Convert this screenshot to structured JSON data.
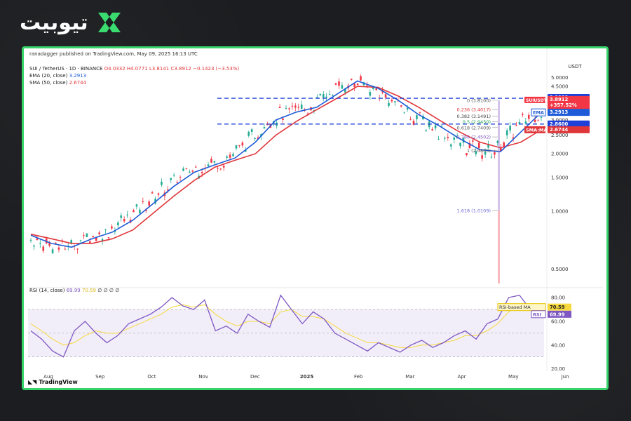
{
  "brand": {
    "name": "تیوبیت"
  },
  "published": "ranadagger published on TradingView.com, May 09, 2025 16:13 UTC",
  "symbol_line": {
    "name": "SUI / TetherUS · 1D · BINANCE",
    "ohlc": "O4.0332 H4.0771 L3.8141 C3.8912 −0.1423 (−3.53%)"
  },
  "ema_legend": {
    "label": "EMA (20, close)",
    "value": "3.2913"
  },
  "sma_legend": {
    "label": "SMA (50, close)",
    "value": "2.6744"
  },
  "rsi_legend": {
    "label": "RSI (14, close)",
    "v1": "69.99",
    "v2": "70.59",
    "rest": "∅ ∅ ∅ ∅"
  },
  "footer": {
    "tradingview": "TradingView"
  },
  "colors": {
    "green": "#22ab94",
    "red": "#f23645",
    "ema": "#1e5bd8",
    "sma": "#e0363a",
    "rsi": "#7e57c2",
    "rsi_ma": "#f7d83d",
    "accent": "#37d46a"
  },
  "chart_data": [
    {
      "type": "line",
      "title": "SUI / TetherUS · 1D · BINANCE",
      "currency": "USDT",
      "x_ticks": [
        "Aug",
        "Sep",
        "Oct",
        "Nov",
        "Dec",
        "2025",
        "Feb",
        "Mar",
        "Apr",
        "May",
        "Jun"
      ],
      "y_ticks": [
        "5.0000",
        "4.5000",
        "4.0000",
        "3.5000",
        "3.0000",
        "2.5000",
        "2.0000",
        "1.5000",
        "1.0000",
        "0.5000"
      ],
      "y_scale": "log",
      "ylim": [
        0.42,
        5.9
      ],
      "series": [
        {
          "name": "EMA",
          "values": [
            0.75,
            0.68,
            0.65,
            0.72,
            0.78,
            0.9,
            1.1,
            1.35,
            1.6,
            1.75,
            1.9,
            2.3,
            3.0,
            3.3,
            3.5,
            4.1,
            4.8,
            4.4,
            3.8,
            3.2,
            2.8,
            2.4,
            2.1,
            2.05,
            2.6,
            3.29
          ]
        },
        {
          "name": "SMA",
          "values": [
            0.76,
            0.72,
            0.68,
            0.68,
            0.72,
            0.8,
            0.98,
            1.2,
            1.45,
            1.7,
            1.85,
            2.0,
            2.5,
            2.95,
            3.4,
            3.9,
            4.5,
            4.45,
            4.0,
            3.5,
            3.0,
            2.6,
            2.3,
            2.15,
            2.3,
            2.67
          ]
        }
      ],
      "horizontal_levels": [
        {
          "label": "3.9000",
          "value": 3.9,
          "style": "dashed"
        },
        {
          "label": "2.8600",
          "value": 2.86,
          "style": "dashed"
        }
      ],
      "fib_levels": [
        {
          "label": "0 (3.8100)",
          "value": 3.81
        },
        {
          "label": "0.236 (3.4017)",
          "value": 3.4017
        },
        {
          "label": "0.382 (3.1491)",
          "value": 3.1491
        },
        {
          "label": "0.5 (2.9450)",
          "value": 2.945
        },
        {
          "label": "0.618 (2.7409)",
          "value": 2.7409
        },
        {
          "label": "0.786 (2.4502)",
          "value": 2.4502
        },
        {
          "label": "1 (2.0800)",
          "value": 2.08
        },
        {
          "label": "1.618 (1.0109)",
          "value": 1.0109
        }
      ],
      "price_tags": [
        {
          "text": "3.9000",
          "color": "#1e40d8"
        },
        {
          "text": "SUIUSDT",
          "value": "3.8912",
          "extra": "+357.52%",
          "timer": "07:46:16",
          "color": "#f23645"
        },
        {
          "text": "EMA",
          "value": "3.2913",
          "color": "#1e5bd8"
        },
        {
          "text": "2.8600",
          "color": "#1e40d8"
        },
        {
          "text": "SMA:MA",
          "value": "2.6744",
          "color": "#e0363a"
        }
      ]
    },
    {
      "type": "line",
      "title": "RSI (14, close)",
      "y_ticks": [
        "80.00",
        "60.00",
        "40.00",
        "20.00"
      ],
      "ylim": [
        18,
        86
      ],
      "band": [
        30,
        70
      ],
      "series": [
        {
          "name": "RSI",
          "values": [
            52,
            45,
            35,
            30,
            52,
            60,
            50,
            42,
            48,
            58,
            62,
            66,
            72,
            80,
            73,
            70,
            78,
            52,
            56,
            50,
            66,
            60,
            55,
            82,
            70,
            58,
            68,
            62,
            50,
            45,
            40,
            35,
            42,
            38,
            34,
            40,
            44,
            38,
            42,
            48,
            52,
            45,
            58,
            62,
            80,
            82,
            70,
            69.99
          ]
        },
        {
          "name": "RSI-based MA",
          "values": [
            58,
            52,
            45,
            40,
            42,
            48,
            52,
            50,
            50,
            54,
            58,
            62,
            66,
            72,
            74,
            72,
            74,
            66,
            60,
            56,
            60,
            60,
            58,
            68,
            70,
            64,
            64,
            62,
            56,
            50,
            46,
            42,
            42,
            40,
            38,
            38,
            40,
            40,
            42,
            44,
            48,
            48,
            52,
            58,
            68,
            74,
            72,
            70.59
          ]
        }
      ],
      "tags": [
        {
          "text": "RSI-based MA",
          "value": "70.59",
          "color": "#f7d83d"
        },
        {
          "text": "RSI",
          "value": "69.99",
          "color": "#7e57c2"
        }
      ]
    }
  ]
}
